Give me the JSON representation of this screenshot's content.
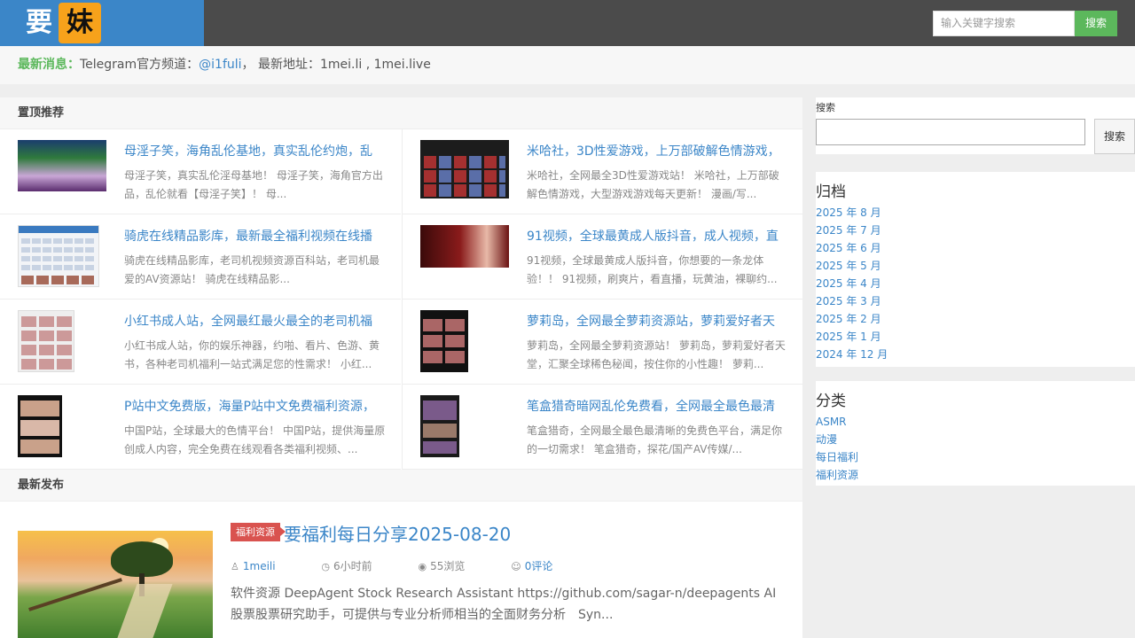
{
  "header": {
    "logo_char1": "要",
    "logo_char2": "妹",
    "search_placeholder": "输入关键字搜索",
    "search_button": "搜索"
  },
  "notice": {
    "label": "最新消息：",
    "text1": "Telegram官方频道：",
    "link1": "@i1fuli",
    "text2": "， 最新地址：",
    "link2": "1mei.li",
    "sep": " , ",
    "link3": "1mei.live"
  },
  "featured": {
    "heading": "置顶推荐",
    "items": [
      {
        "title": "母淫子笑，海角乱伦基地，真实乱伦约炮，乱",
        "desc": "母淫子笑，真实乱伦淫母基地！ 母淫子笑，海角官方出品，乱伦就看【母淫子笑】！ 母..."
      },
      {
        "title": "米哈社，3D性爱游戏，上万部破解色情游戏，",
        "desc": "米哈社，全网最全3D性爱游戏站！ 米哈社，上万部破解色情游戏，大型游戏游戏每天更新！ 漫画/写..."
      },
      {
        "title": "骑虎在线精品影库，最新最全福利视频在线播",
        "desc": "骑虎在线精品影库，老司机视频资源百科站，老司机最爱的AV资源站！ 骑虎在线精品影..."
      },
      {
        "title": "91视频，全球最黄成人版抖音，成人视频，直",
        "desc": "91视频，全球最黄成人版抖音，你想要的一条龙体验！！ 91视频，刷爽片，看直播，玩黄油，裸聊约..."
      },
      {
        "title": "小红书成人站，全网最红最火最全的老司机福",
        "desc": "小红书成人站，你的娱乐神器，约啪、看片、色游、黄书，各种老司机福利一站式满足您的性需求！ 小红..."
      },
      {
        "title": "萝莉岛，全网最全萝莉资源站，萝莉爱好者天",
        "desc": "萝莉岛，全网最全萝莉资源站！ 萝莉岛，萝莉爱好者天堂，汇聚全球稀色秘闻，按住你的小性趣！ 萝莉..."
      },
      {
        "title": "P站中文免费版，海量P站中文免费福利资源，",
        "desc": "中国P站，全球最大的色情平台！ 中国P站，提供海量原创成人内容，完全免费在线观看各类福利视频、..."
      },
      {
        "title": "笔盒猎奇暗网乱伦免费看，全网最全最色最清",
        "desc": "笔盒猎奇，全网最全最色最清晰的免费色平台，满足你的一切需求！ 笔盒猎奇，探花/国产AV传媒/..."
      }
    ]
  },
  "latest": {
    "heading": "最新发布",
    "post": {
      "category": "福利资源",
      "title": "要福利每日分享2025-08-20",
      "author": "1meili",
      "time": "6小时前",
      "views": "55浏览",
      "comments": "0评论",
      "excerpt": "软件资源 DeepAgent Stock Research Assistant https://github.com/sagar-n/deepagents AI股票股票研究助手，可提供与专业分析师相当的全面财务分析　Syn..."
    }
  },
  "sidebar": {
    "search_label": "搜索",
    "search_button": "搜索",
    "archive_title": "归档",
    "archives": [
      "2025 年 8 月",
      "2025 年 7 月",
      "2025 年 6 月",
      "2025 年 5 月",
      "2025 年 4 月",
      "2025 年 3 月",
      "2025 年 2 月",
      "2025 年 1 月",
      "2024 年 12 月"
    ],
    "category_title": "分类",
    "categories": [
      "ASMR",
      "动漫",
      "每日福利",
      "福利资源"
    ]
  },
  "colors": {
    "header_bg": "#4b4b4b",
    "logo_bg": "#3b86c8",
    "logo_accent": "#f7a21b",
    "link": "#3b86c8",
    "green": "#5cb85c",
    "badge_red": "#d9534f"
  }
}
